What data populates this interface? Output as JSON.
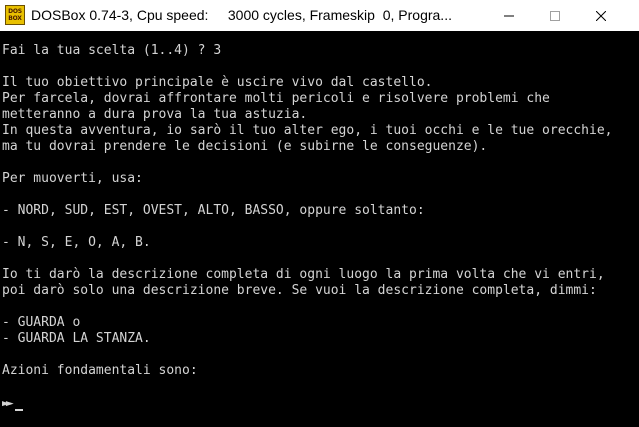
{
  "window": {
    "title": "DOSBox 0.74-3, Cpu speed:     3000 cycles, Frameskip  0, Progra...",
    "icon_top": "DOS",
    "icon_bottom": "BOX",
    "controls": {
      "minimize": "minimize-icon",
      "maximize": "maximize-icon",
      "close": "close-icon"
    }
  },
  "console": {
    "lines": [
      "Fai la tua scelta (1..4) ? 3",
      "",
      "Il tuo obiettivo principale è uscire vivo dal castello.",
      "Per farcela, dovrai affrontare molti pericoli e risolvere problemi che",
      "metteranno a dura prova la tua astuzia.",
      "In questa avventura, io sarò il tuo alter ego, i tuoi occhi e le tue orecchie,",
      "ma tu dovrai prendere le decisioni (e subirne le conseguenze).",
      "",
      "Per muoverti, usa:",
      "",
      "- NORD, SUD, EST, OVEST, ALTO, BASSO, oppure soltanto:",
      "",
      "- N, S, E, O, A, B.",
      "",
      "Io ti darò la descrizione completa di ogni luogo la prima volta che vi entri,",
      "poi darò solo una descrizione breve. Se vuoi la descrizione completa, dimmi:",
      "",
      "- GUARDA o",
      "- GUARDA LA STANZA.",
      "",
      "Azioni fondamentali sono:"
    ],
    "prompt": "►►",
    "text_color": "#d4d4d4",
    "background": "#000000"
  }
}
